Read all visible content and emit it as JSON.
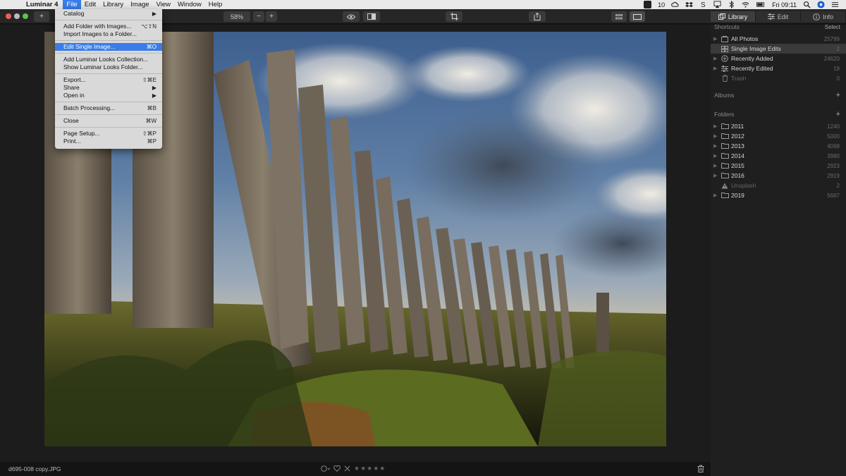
{
  "menubar": {
    "app_name": "Luminar 4",
    "items": [
      "File",
      "Edit",
      "Library",
      "Image",
      "View",
      "Window",
      "Help"
    ],
    "status_count": "10",
    "clock": "Fri 09:11"
  },
  "toolbar": {
    "add_label": "+",
    "zoom": "58%",
    "zoom_out": "−",
    "zoom_in": "+"
  },
  "tabs": [
    "Library",
    "Edit",
    "Info"
  ],
  "file_menu": {
    "items": [
      {
        "label": "Catalog",
        "shortcut": "▶"
      },
      {
        "label": "Add Folder with Images...",
        "shortcut": "⌥⇧N"
      },
      {
        "label": "Import Images to a Folder...",
        "shortcut": ""
      },
      {
        "label": "Edit Single Image...",
        "shortcut": "⌘O"
      },
      {
        "label": "Add Luminar Looks Collection...",
        "shortcut": ""
      },
      {
        "label": "Show Luminar Looks Folder...",
        "shortcut": ""
      },
      {
        "label": "Export...",
        "shortcut": "⇧⌘E"
      },
      {
        "label": "Share",
        "shortcut": "▶"
      },
      {
        "label": "Open in",
        "shortcut": "▶"
      },
      {
        "label": "Batch Processing...",
        "shortcut": "⌘B"
      },
      {
        "label": "Close",
        "shortcut": "⌘W"
      },
      {
        "label": "Page Setup...",
        "shortcut": "⇧⌘P"
      },
      {
        "label": "Print...",
        "shortcut": "⌘P"
      }
    ]
  },
  "panel": {
    "shortcuts_title": "Shortcuts",
    "select_label": "Select",
    "shortcuts": [
      {
        "name": "All Photos",
        "count": "25799"
      },
      {
        "name": "Single Image Edits",
        "count": "2"
      },
      {
        "name": "Recently Added",
        "count": "24620"
      },
      {
        "name": "Recently Edited",
        "count": "19"
      },
      {
        "name": "Trash",
        "count": "0"
      }
    ],
    "albums_title": "Albums",
    "albums_add": "+",
    "folders_title": "Folders",
    "folders_add": "+",
    "folders": [
      {
        "name": "2011",
        "count": "1240"
      },
      {
        "name": "2012",
        "count": "5000"
      },
      {
        "name": "2013",
        "count": "4068"
      },
      {
        "name": "2014",
        "count": "3980"
      },
      {
        "name": "2015",
        "count": "2923"
      },
      {
        "name": "2016",
        "count": "2919"
      },
      {
        "name": "Unsplash",
        "count": "2"
      },
      {
        "name": "2019",
        "count": "5667"
      }
    ]
  },
  "status": {
    "filename": "d695-008 copy.JPG",
    "stars": "★★★★★"
  },
  "colors": {
    "accent": "#3a7de8",
    "panel_bg": "#1f1f1f",
    "canvas_bg": "#1c1c1c"
  }
}
